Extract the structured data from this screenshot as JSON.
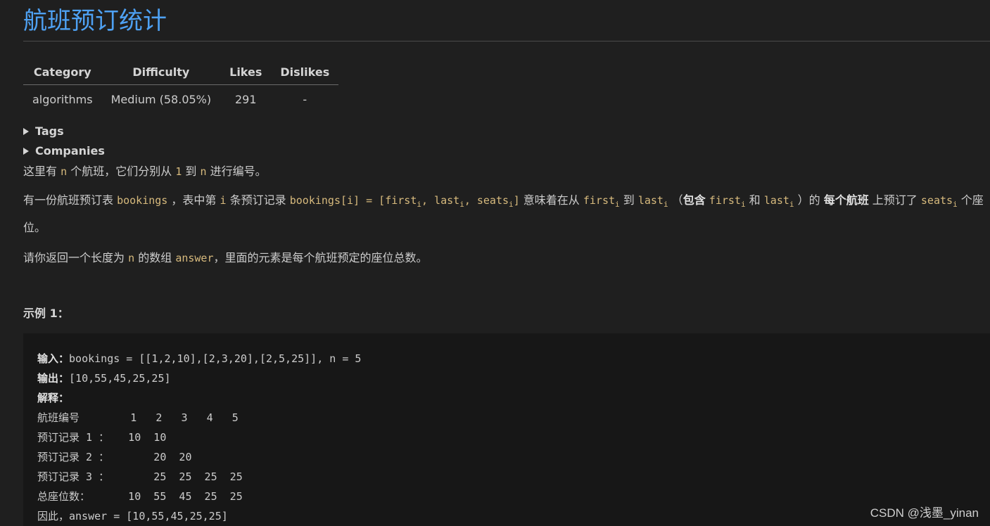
{
  "title": "航班预订统计",
  "meta_table": {
    "headers": [
      "Category",
      "Difficulty",
      "Likes",
      "Dislikes"
    ],
    "row": [
      "algorithms",
      "Medium (58.05%)",
      "291",
      "-"
    ]
  },
  "details": {
    "tags_label": "Tags",
    "companies_label": "Companies"
  },
  "para1": {
    "t1": "这里有 ",
    "c1": "n",
    "t2": " 个航班，它们分别从 ",
    "c2": "1",
    "t3": " 到 ",
    "c3": "n",
    "t4": " 进行编号。"
  },
  "para2": {
    "t1": "有一份航班预订表 ",
    "c1": "bookings",
    "t2": " ，表中第 ",
    "c2": "i",
    "t3": " 条预订记录 ",
    "c3a": "bookings[i] = [first",
    "c3b": ", last",
    "c3c": ", seats",
    "c3d": "]",
    "sub": "i",
    "t4": " 意味着在从 ",
    "c4": "first",
    "t5": " 到 ",
    "c5": "last",
    "t6": " （",
    "s1": "包含",
    "t7": " ",
    "c6": "first",
    "t8": " 和 ",
    "c7": "last",
    "t9": " ）的 ",
    "s2": "每个航班",
    "t10": " 上预订了 ",
    "c8": "seats",
    "t11": " 个座位。"
  },
  "para3": {
    "t1": "请你返回一个长度为 ",
    "c1": "n",
    "t2": " 的数组 ",
    "c2": "answer",
    "t3": "，里面的元素是每个航班预定的座位总数。"
  },
  "example": {
    "heading": "示例 1：",
    "input_label": "输入：",
    "input_value": "bookings = [[1,2,10],[2,3,20],[2,5,25]], n = 5",
    "output_label": "输出：",
    "output_value": "[10,55,45,25,25]",
    "explain_label": "解释：",
    "lines": [
      "航班编号        1   2   3   4   5",
      "预订记录 1 ：   10  10",
      "预订记录 2 ：       20  20",
      "预订记录 3 ：       25  25  25  25",
      "总座位数：      10  55  45  25  25",
      "因此，answer = [10,55,45,25,25]"
    ]
  },
  "watermark": "CSDN @浅墨_yinan"
}
